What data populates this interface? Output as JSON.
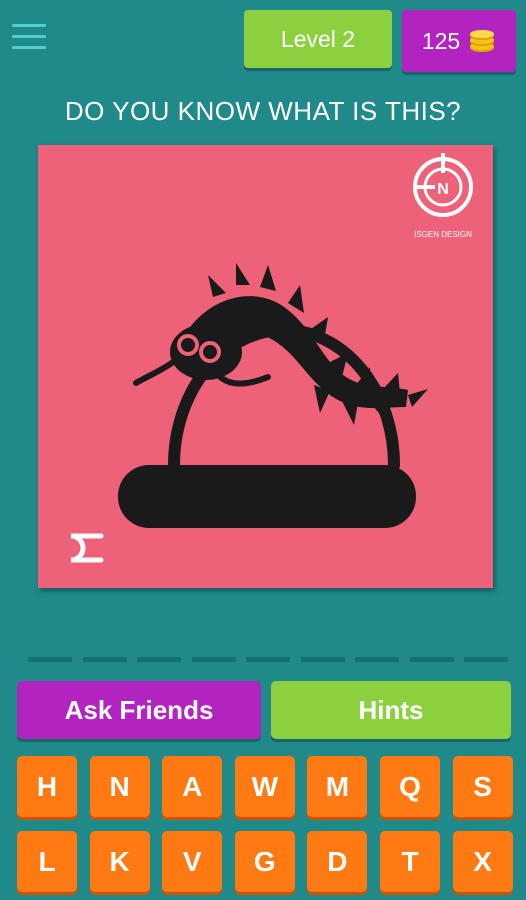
{
  "header": {
    "level_label": "Level 2",
    "coins": "125"
  },
  "question": "DO YOU KNOW WHAT IS THIS?",
  "puzzle": {
    "watermark_text": "ISGEN DESIGN",
    "background_color": "#ee6279",
    "icon": "worm-in-glass-dome-icon"
  },
  "actions": {
    "ask_friends": "Ask Friends",
    "hints": "Hints"
  },
  "answer_slots": 9,
  "keyboard": {
    "row1": [
      "H",
      "N",
      "A",
      "W",
      "M",
      "Q",
      "S"
    ],
    "row2": [
      "L",
      "K",
      "V",
      "G",
      "D",
      "T",
      "X"
    ]
  },
  "colors": {
    "background": "#1f8a89",
    "green": "#8bd13f",
    "purple": "#b224bf",
    "orange": "#ff7a12"
  }
}
